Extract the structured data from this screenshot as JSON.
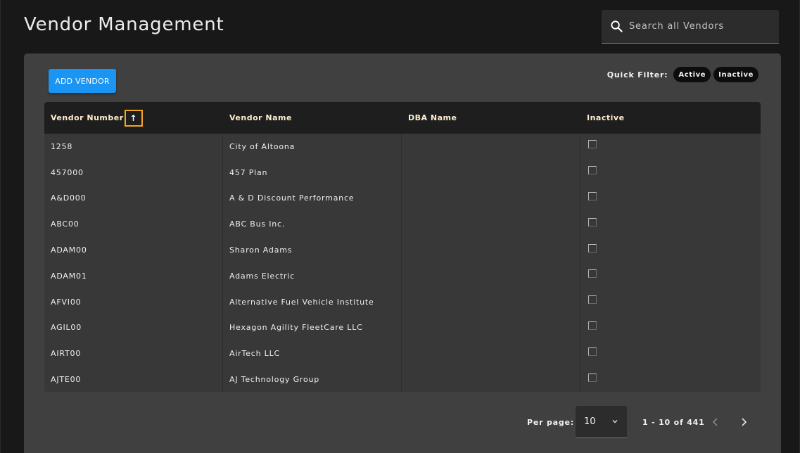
{
  "header": {
    "title": "Vendor Management",
    "search_placeholder": "Search all Vendors"
  },
  "toolbar": {
    "add_label": "ADD VENDOR",
    "quick_filter_label": "Quick Filter:",
    "filters": [
      "Active",
      "Inactive"
    ]
  },
  "table": {
    "columns": [
      "Vendor Number",
      "Vendor Name",
      "DBA Name",
      "Inactive"
    ],
    "sort_indicator": "↑",
    "rows": [
      {
        "number": "1258",
        "name": "City of Altoona",
        "dba": "",
        "inactive": false
      },
      {
        "number": "457000",
        "name": "457 Plan",
        "dba": "",
        "inactive": false
      },
      {
        "number": "A&D000",
        "name": "A & D Discount Performance",
        "dba": "",
        "inactive": false
      },
      {
        "number": "ABC00",
        "name": "ABC Bus Inc.",
        "dba": "",
        "inactive": false
      },
      {
        "number": "ADAM00",
        "name": "Sharon Adams",
        "dba": "",
        "inactive": false
      },
      {
        "number": "ADAM01",
        "name": "Adams Electric",
        "dba": "",
        "inactive": false
      },
      {
        "number": "AFVI00",
        "name": "Alternative Fuel Vehicle Institute",
        "dba": "",
        "inactive": false
      },
      {
        "number": "AGIL00",
        "name": "Hexagon Agility FleetCare LLC",
        "dba": "",
        "inactive": false
      },
      {
        "number": "AIRT00",
        "name": "AirTech LLC",
        "dba": "",
        "inactive": false
      },
      {
        "number": "AJTE00",
        "name": "AJ Technology Group",
        "dba": "",
        "inactive": false
      }
    ]
  },
  "pagination": {
    "per_page_label": "Per page:",
    "per_page_value": "10",
    "range": "1 - 10 of 441"
  },
  "icons": {
    "search": "search-icon",
    "sort": "sort-asc-icon",
    "chevron": "chevron-down-icon",
    "prev": "chevron-left-icon",
    "next": "chevron-right-icon"
  },
  "colors": {
    "accent": "#1a95f3",
    "sort_highlight": "#f5a623",
    "header_text": "#ffefcf"
  }
}
